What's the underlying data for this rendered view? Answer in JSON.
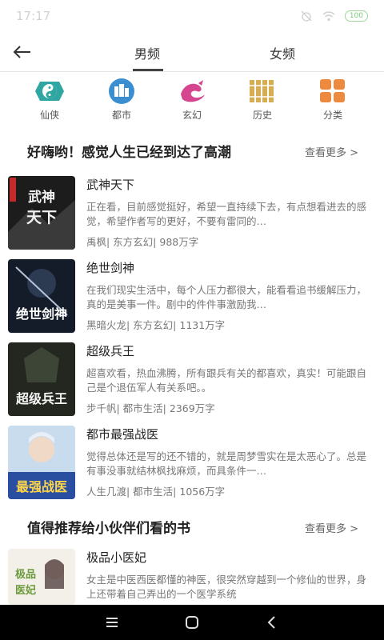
{
  "status_bar": {
    "time": "17:17",
    "battery": "100"
  },
  "header": {
    "tabs": [
      {
        "label": "男频"
      },
      {
        "label": "女频"
      }
    ]
  },
  "categories": [
    {
      "label": "仙侠",
      "icon": "yin-yang-icon",
      "color": "#2fa6a1"
    },
    {
      "label": "都市",
      "icon": "city-buildings-icon",
      "color": "#3b8fd0"
    },
    {
      "label": "玄幻",
      "icon": "dragon-icon",
      "color": "#d64590"
    },
    {
      "label": "历史",
      "icon": "bamboo-scroll-icon",
      "color": "#d6ad52"
    },
    {
      "label": "分类",
      "icon": "grid-icon",
      "color": "#ee8a3d"
    }
  ],
  "sections": [
    {
      "title": "好嗨哟！感觉人生已经到达了高潮",
      "more": "查看更多 >",
      "books": [
        {
          "title": "武神天下",
          "desc": "正在看，目前感觉挺好，希望一直持续下去，有点想看进去的感觉，希望作者写的更好，不要有雷同的…",
          "meta": "禹枫| 东方玄幻| 988万字",
          "cover_text": "武神天下"
        },
        {
          "title": "绝世剑神",
          "desc": "在我们现实生活中，每个人压力都很大，能看看追书缓解压力，真的是美事一件。剧中的件件事激励我…",
          "meta": "黑暗火龙| 东方玄幻| 1131万字",
          "cover_text": "绝世剑神"
        },
        {
          "title": "超级兵王",
          "desc": "超喜欢看，热血沸腾，所有跟兵有关的都喜欢，真实！可能跟自己是个退伍军人有关系吧。。",
          "meta": "步千帆| 都市生活| 2369万字",
          "cover_text": "超级兵王"
        },
        {
          "title": "都市最强战医",
          "desc": "觉得总体还是写的还不错的，就是周梦雪实在是太恶心了。总是有事没事就结林枫找麻烦，而具条件一…",
          "meta": "人生几渡| 都市生活| 1056万字",
          "cover_text": "最强战医"
        }
      ]
    },
    {
      "title": "值得推荐给小伙伴们看的书",
      "more": "查看更多 >",
      "books": [
        {
          "title": "极品小医妃",
          "desc": "女主是中医西医都懂的神医，很突然穿越到一个修仙的世界，身上还带着自己弄出的一个医学系统",
          "meta": "",
          "cover_text": "极品小医妃"
        }
      ]
    }
  ]
}
